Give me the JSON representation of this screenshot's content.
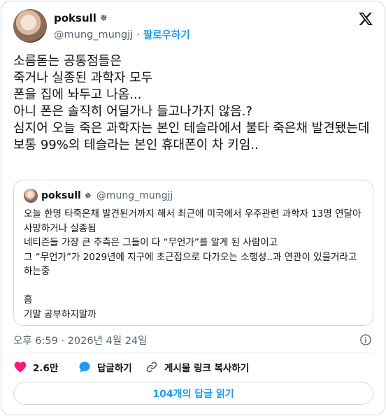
{
  "author": {
    "display_name": "poksull",
    "badge_icon": "ornament-icon",
    "handle": "@mung_mungjj",
    "separator": "·",
    "follow_label": "팔로우하기"
  },
  "brand": {
    "logo": "x-logo-icon"
  },
  "tweet": {
    "text": "소름돋는 공통점들은\n죽거나 실종된 과학자 모두\n폰을 집에 놔두고 나옴...\n아니 폰은 솔직히 어딜가나 들고나가지 않음.?\n심지어 오늘 죽은 과학자는 본인 테슬라에서 불타 죽은채 발견됐는데\n보통 99%의 테슬라는 본인 휴대폰이 차 키임.."
  },
  "quote": {
    "display_name": "poksull",
    "handle": "@mung_mungjj",
    "text": "오늘 한명 타죽은채 발견된거까지 해서 최근에 미국에서 우주관련 과학자 13명 연달아 사망하거나 실종됨\n네티즌들 가장 큰 추측은 그들이 다 “무언가”를 알게 된 사람이고\n그 “무언가”가 2029년에 지구에 초근접으로 다가오는 소행성..과 연관이 있을거라고 하는중\n\n흠\n기말 공부하지말까"
  },
  "meta": {
    "timestamp": "오후 6:59 · 2026년 4월 24일"
  },
  "actions": {
    "like_count": "2.6만",
    "reply_label": "답글하기",
    "copy_link_label": "게시물 링크 복사하기"
  },
  "read_replies_label": "104개의 답글 읽기",
  "colors": {
    "accent": "#1d9bf0",
    "like": "#f91880",
    "text": "#0f1419",
    "secondary": "#536471",
    "border": "#cfd9de"
  }
}
